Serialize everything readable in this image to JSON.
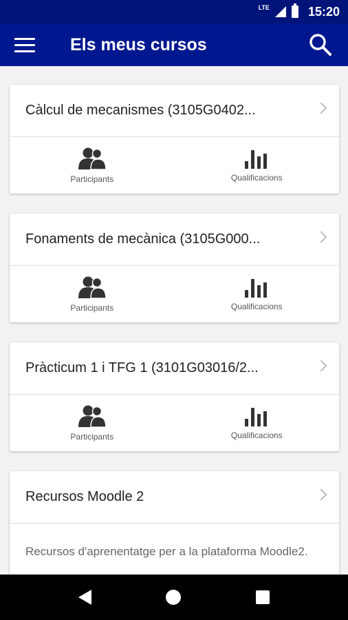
{
  "status_bar": {
    "network": "LTE",
    "time": "15:20"
  },
  "app_bar": {
    "title": "Els meus cursos"
  },
  "courses": [
    {
      "title": "Càlcul de mecanismes (3105G0402...",
      "actions": [
        "Participants",
        "Qualificacions"
      ]
    },
    {
      "title": "Fonaments de mecànica (3105G000...",
      "actions": [
        "Participants",
        "Qualificacions"
      ]
    },
    {
      "title": "Pràcticum 1 i TFG 1 (3101G03016/2...",
      "actions": [
        "Participants",
        "Qualificacions"
      ]
    },
    {
      "title": "Recursos Moodle 2",
      "description": "Recursos d'aprenentatge per a la plataforma Moodle2."
    }
  ],
  "icons": {
    "participants": "people-icon",
    "grades": "bar-chart-icon",
    "open": "chevron-right-icon"
  },
  "colors": {
    "status_bar": "#00147a",
    "app_bar": "#00188f",
    "background": "#f2f2f2"
  }
}
